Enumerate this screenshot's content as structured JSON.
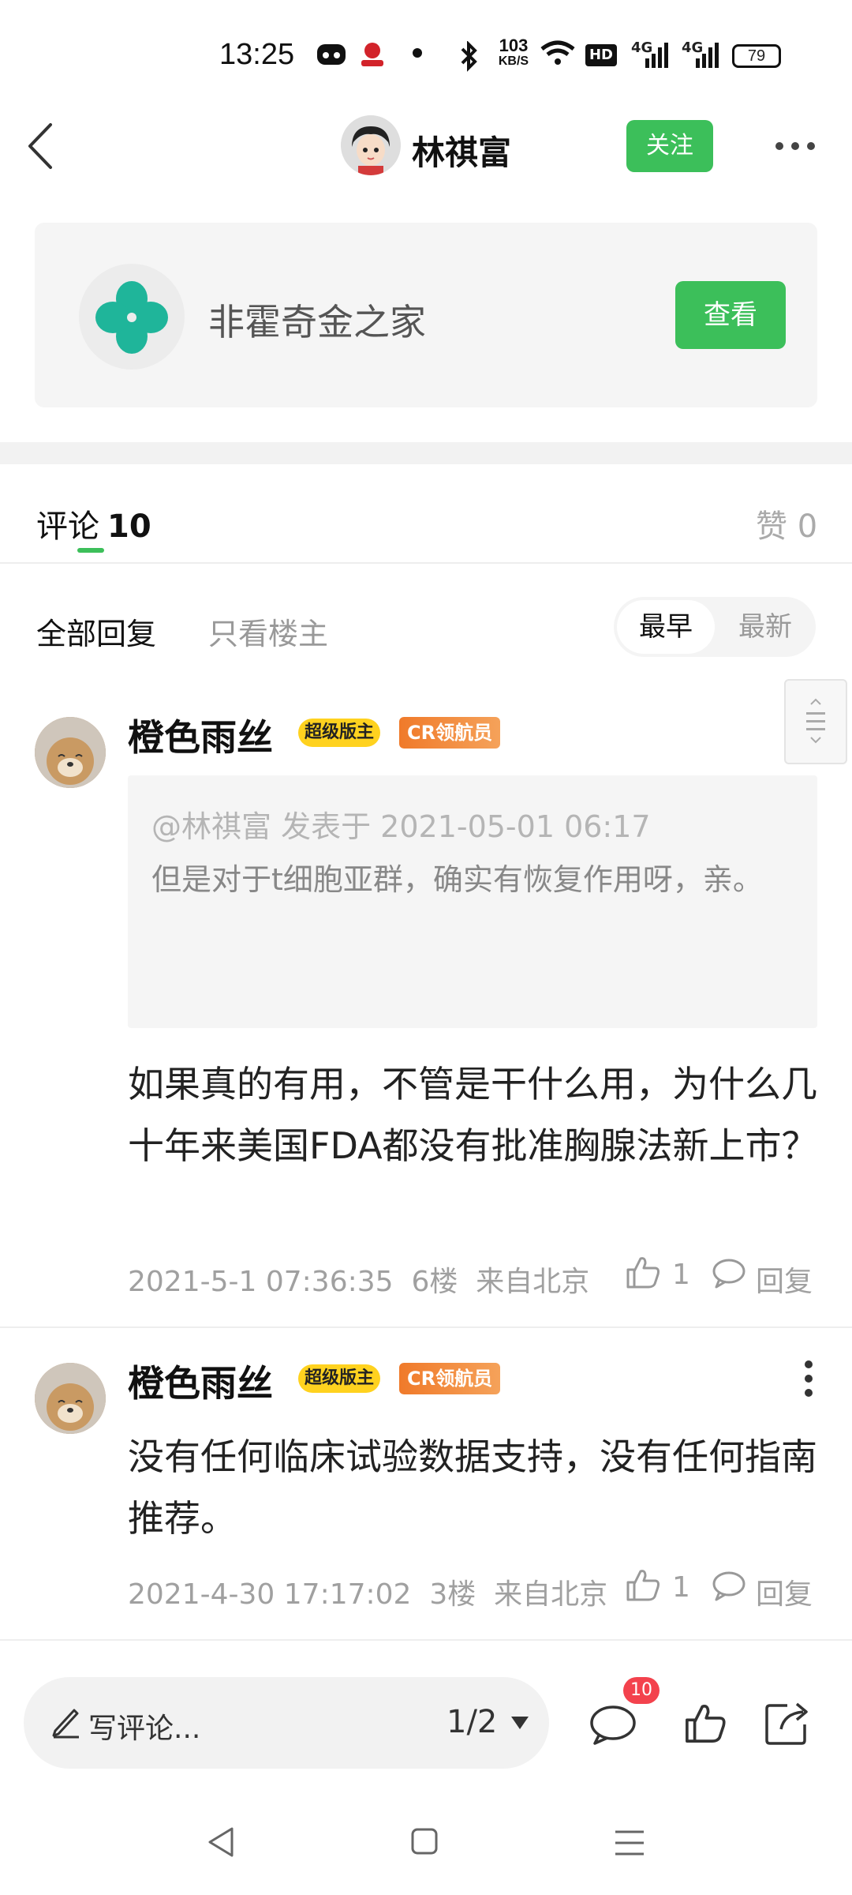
{
  "status_bar": {
    "time": "13:25",
    "net_speed_top": "103",
    "net_speed_bottom": "KB/S",
    "hd_label": "HD",
    "signal1_label": "4G",
    "signal2_label": "4G",
    "battery": "79"
  },
  "header": {
    "username": "林祺富",
    "follow_label": "关注"
  },
  "group": {
    "name": "非霍奇金之家",
    "view_label": "查看"
  },
  "tabs": {
    "comments_label": "评论",
    "comments_count": "10",
    "likes_label": "赞",
    "likes_count": "0"
  },
  "filters": {
    "all_label": "全部回复",
    "op_only_label": "只看楼主",
    "sort_earliest": "最早",
    "sort_newest": "最新"
  },
  "comments": [
    {
      "author": "橙色雨丝",
      "badge1": "超级版主",
      "badge2": "CR领航员",
      "quote_meta": "@林祺富 发表于 2021-05-01 06:17",
      "quote_text": "但是对于t细胞亚群，确实有恢复作用呀，亲。",
      "body": "如果真的有用，不管是干什么用，为什么几十年来美国FDA都没有批准胸腺法新上市？",
      "time": "2021-5-1 07:36:35",
      "floor": "6楼",
      "location": "来自北京",
      "likes": "1",
      "reply_label": "回复"
    },
    {
      "author": "橙色雨丝",
      "badge1": "超级版主",
      "badge2": "CR领航员",
      "body": "没有任何临床试验数据支持，没有任何指南推荐。",
      "time": "2021-4-30 17:17:02",
      "floor": "3楼",
      "location": "来自北京",
      "likes": "1",
      "reply_label": "回复"
    }
  ],
  "bottom_bar": {
    "comment_placeholder": "写评论...",
    "page_indicator": "1/2",
    "comment_badge": "10"
  },
  "colors": {
    "accent_green": "#3cbf5a",
    "badge_yellow": "#ffd21f",
    "badge_orange": "#f07a2a",
    "notif_red": "#f3424d"
  }
}
